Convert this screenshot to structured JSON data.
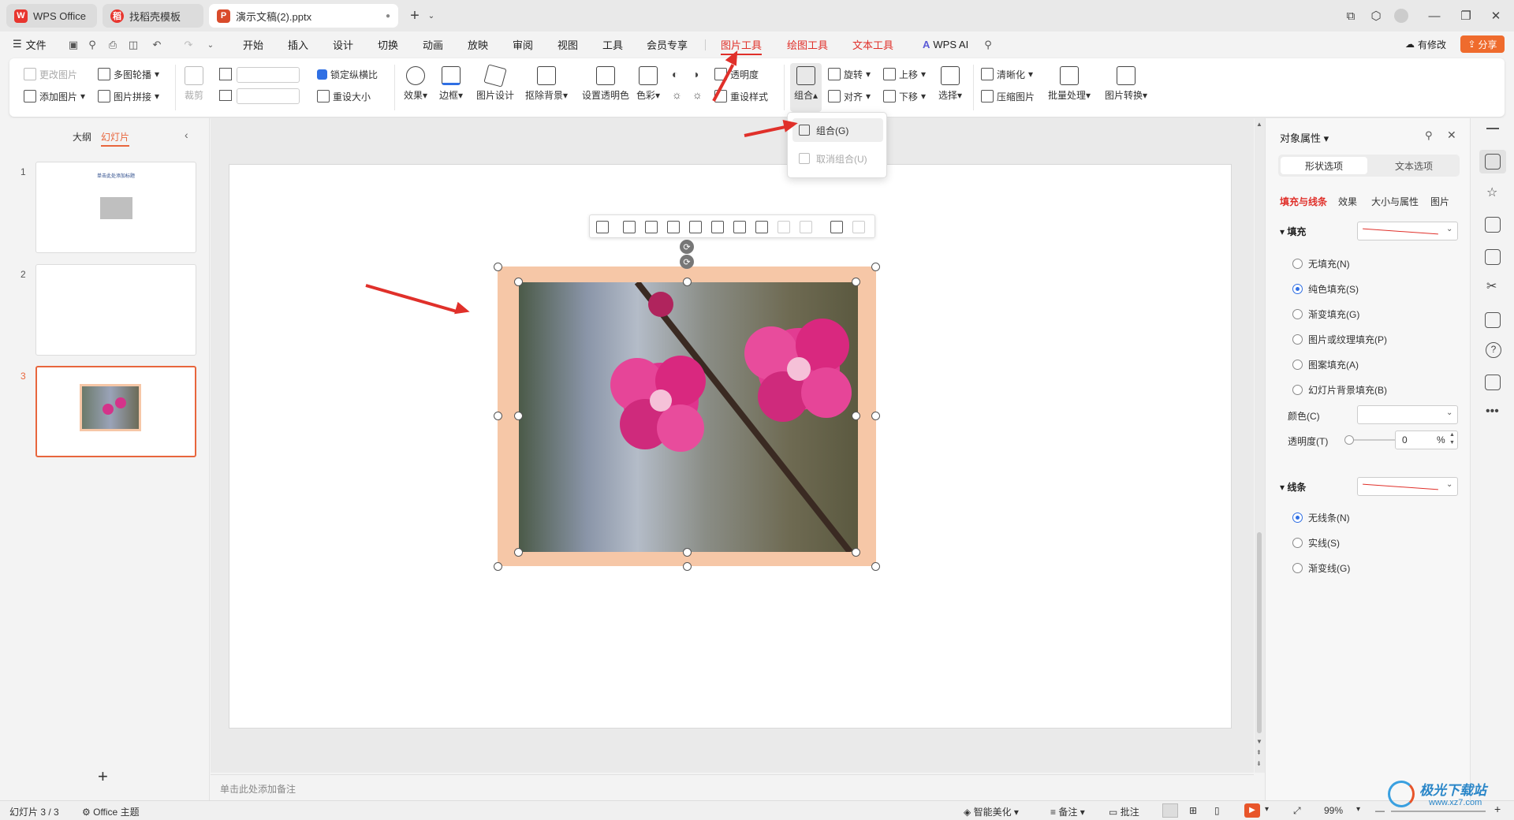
{
  "tabs": [
    {
      "label": "WPS Office",
      "logo": "W",
      "logo_color": "#e8362f"
    },
    {
      "label": "找稻壳模板",
      "logo": "稻",
      "logo_color": "#e8362f"
    },
    {
      "label": "演示文稿(2).pptx",
      "logo": "P",
      "logo_color": "#d94b2b"
    }
  ],
  "menu": {
    "file": "文件",
    "items": [
      "开始",
      "插入",
      "设计",
      "切换",
      "动画",
      "放映",
      "审阅",
      "视图",
      "工具",
      "会员专享"
    ],
    "context_tabs": [
      "图片工具",
      "绘图工具",
      "文本工具"
    ],
    "wps_ai": "WPS AI",
    "has_changes": "有修改",
    "share": "分享"
  },
  "ribbon": {
    "change_picture": "更改图片",
    "add_picture": "添加图片",
    "multi_outline": "多图轮播",
    "picture_collage": "图片拼接",
    "crop": "裁剪",
    "lock_ratio": "锁定纵横比",
    "reset_size": "重设大小",
    "effects": "效果",
    "border": "边框",
    "picture_design": "图片设计",
    "remove_bg": "抠除背景",
    "set_transparent": "设置透明色",
    "color": "色彩",
    "transparency": "透明度",
    "reset_style": "重设样式",
    "group": "组合",
    "rotate": "旋转",
    "align": "对齐",
    "move_up": "上移",
    "move_down": "下移",
    "select": "选择",
    "sharpen": "清晰化",
    "compress": "压缩图片",
    "batch": "批量处理",
    "convert": "图片转换"
  },
  "group_menu": {
    "group": "组合(G)",
    "ungroup": "取消组合(U)"
  },
  "left_panel": {
    "outline_tab": "大纲",
    "slides_tab": "幻灯片",
    "slide1_title": "单击此处添加标题",
    "slide_numbers": [
      "1",
      "2",
      "3"
    ],
    "add": "+"
  },
  "notes_placeholder": "单击此处添加备注",
  "right_panel": {
    "title": "对象属性",
    "tab_shape": "形状选项",
    "tab_text": "文本选项",
    "subtabs": [
      "填充与线条",
      "效果",
      "大小与属性",
      "图片"
    ],
    "fill_section": "填充",
    "fill_options": [
      "无填充(N)",
      "纯色填充(S)",
      "渐变填充(G)",
      "图片或纹理填充(P)",
      "图案填充(A)",
      "幻灯片背景填充(B)"
    ],
    "fill_selected": 1,
    "color_label": "颜色(C)",
    "transparency_label": "透明度(T)",
    "transparency_value": "0",
    "percent": "%",
    "line_section": "线条",
    "line_options": [
      "无线条(N)",
      "实线(S)",
      "渐变线(G)"
    ],
    "line_selected": 0
  },
  "status": {
    "slide_count": "幻灯片 3 / 3",
    "theme": "Office 主题",
    "beautify": "智能美化",
    "notes": "备注",
    "comments": "批注",
    "zoom": "99%"
  },
  "watermark": {
    "text": "极光下载站",
    "url": "www.xz7.com"
  },
  "colors": {
    "accent": "#e0302a",
    "selection_orange": "#e8663d",
    "picture_border": "#f6c7a7",
    "share_btn": "#ef6b2d"
  }
}
